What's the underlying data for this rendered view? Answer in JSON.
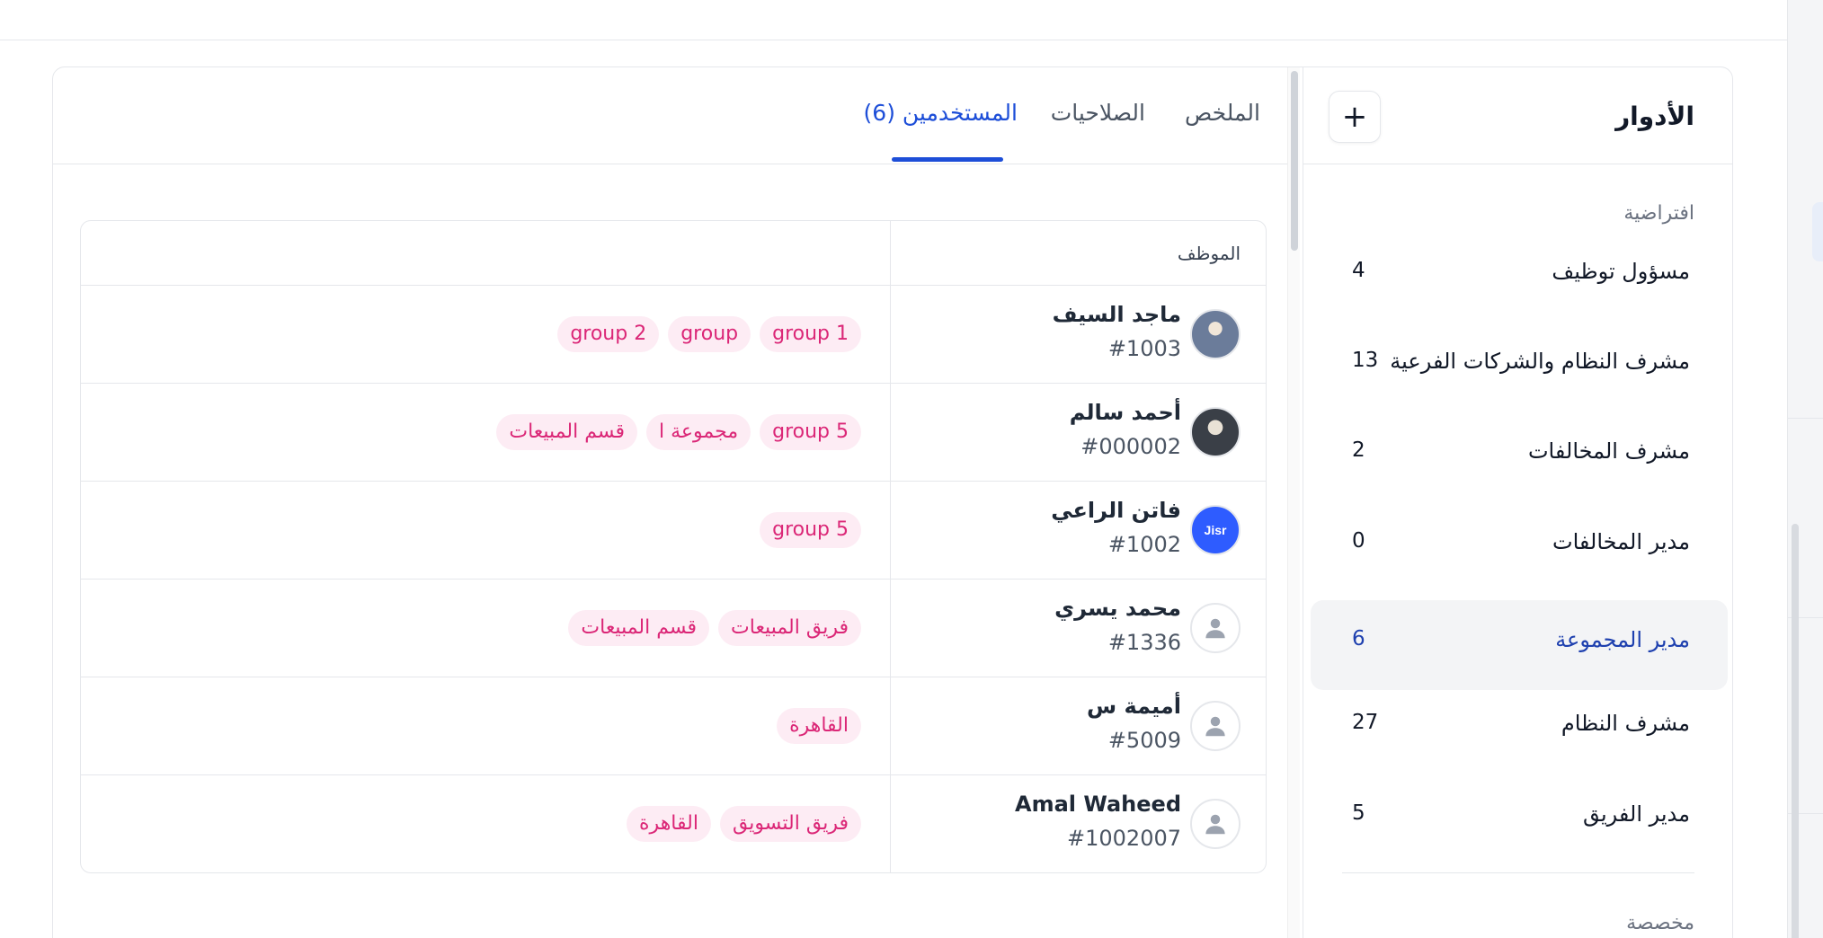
{
  "roles_panel": {
    "title": "الأدوار",
    "add_icon": "plus-icon",
    "add_glyph": "+",
    "group_default_label": "افتراضية",
    "group_custom_label": "مخصصة",
    "roles": [
      {
        "name": "مسؤول توظيف",
        "count": "4"
      },
      {
        "name": "مشرف النظام والشركات الفرعية",
        "count": "13"
      },
      {
        "name": "مشرف المخالفات",
        "count": "2"
      },
      {
        "name": "مدير المخالفات",
        "count": "0"
      },
      {
        "name": "مدير المجموعة",
        "count": "6",
        "active": true
      },
      {
        "name": "مشرف النظام",
        "count": "27"
      },
      {
        "name": "مدير الفريق",
        "count": "5"
      }
    ]
  },
  "tabs": {
    "summary": "الملخص",
    "permissions": "الصلاحيات",
    "users": "المستخدمين (6)",
    "active_tab": "users"
  },
  "table": {
    "header_employee": "الموظف",
    "rows": [
      {
        "name": "ماجد السيف",
        "id": "#1003",
        "avatar": "photo-avatar",
        "tags": [
          "group 1",
          "group",
          "group 2"
        ]
      },
      {
        "name": "أحمد سالم",
        "id": "#000002",
        "avatar": "photo-avatar",
        "tags": [
          "group 5",
          "مجموعة ا",
          "قسم المبيعات"
        ]
      },
      {
        "name": "فاتن الراعي",
        "id": "#1002",
        "avatar": "brand-avatar",
        "avatar_text": "Jisr",
        "tags": [
          "group 5"
        ]
      },
      {
        "name": "محمد يسري",
        "id": "#1336",
        "avatar": "default-user-icon",
        "tags": [
          "فريق المبيعات",
          "قسم المبيعات"
        ]
      },
      {
        "name": "أميمة س",
        "id": "#5009",
        "avatar": "default-user-icon",
        "tags": [
          "القاهرة"
        ]
      },
      {
        "name": "Amal Waheed",
        "id": "#1002007",
        "avatar": "default-user-icon",
        "tags": [
          "فريق التسويق",
          "القاهرة"
        ]
      }
    ]
  },
  "colors": {
    "accent": "#1d4ed8",
    "tag_text": "#db2777",
    "tag_bg": "#fdecf4",
    "active_row_bg": "#f3f4f6"
  }
}
